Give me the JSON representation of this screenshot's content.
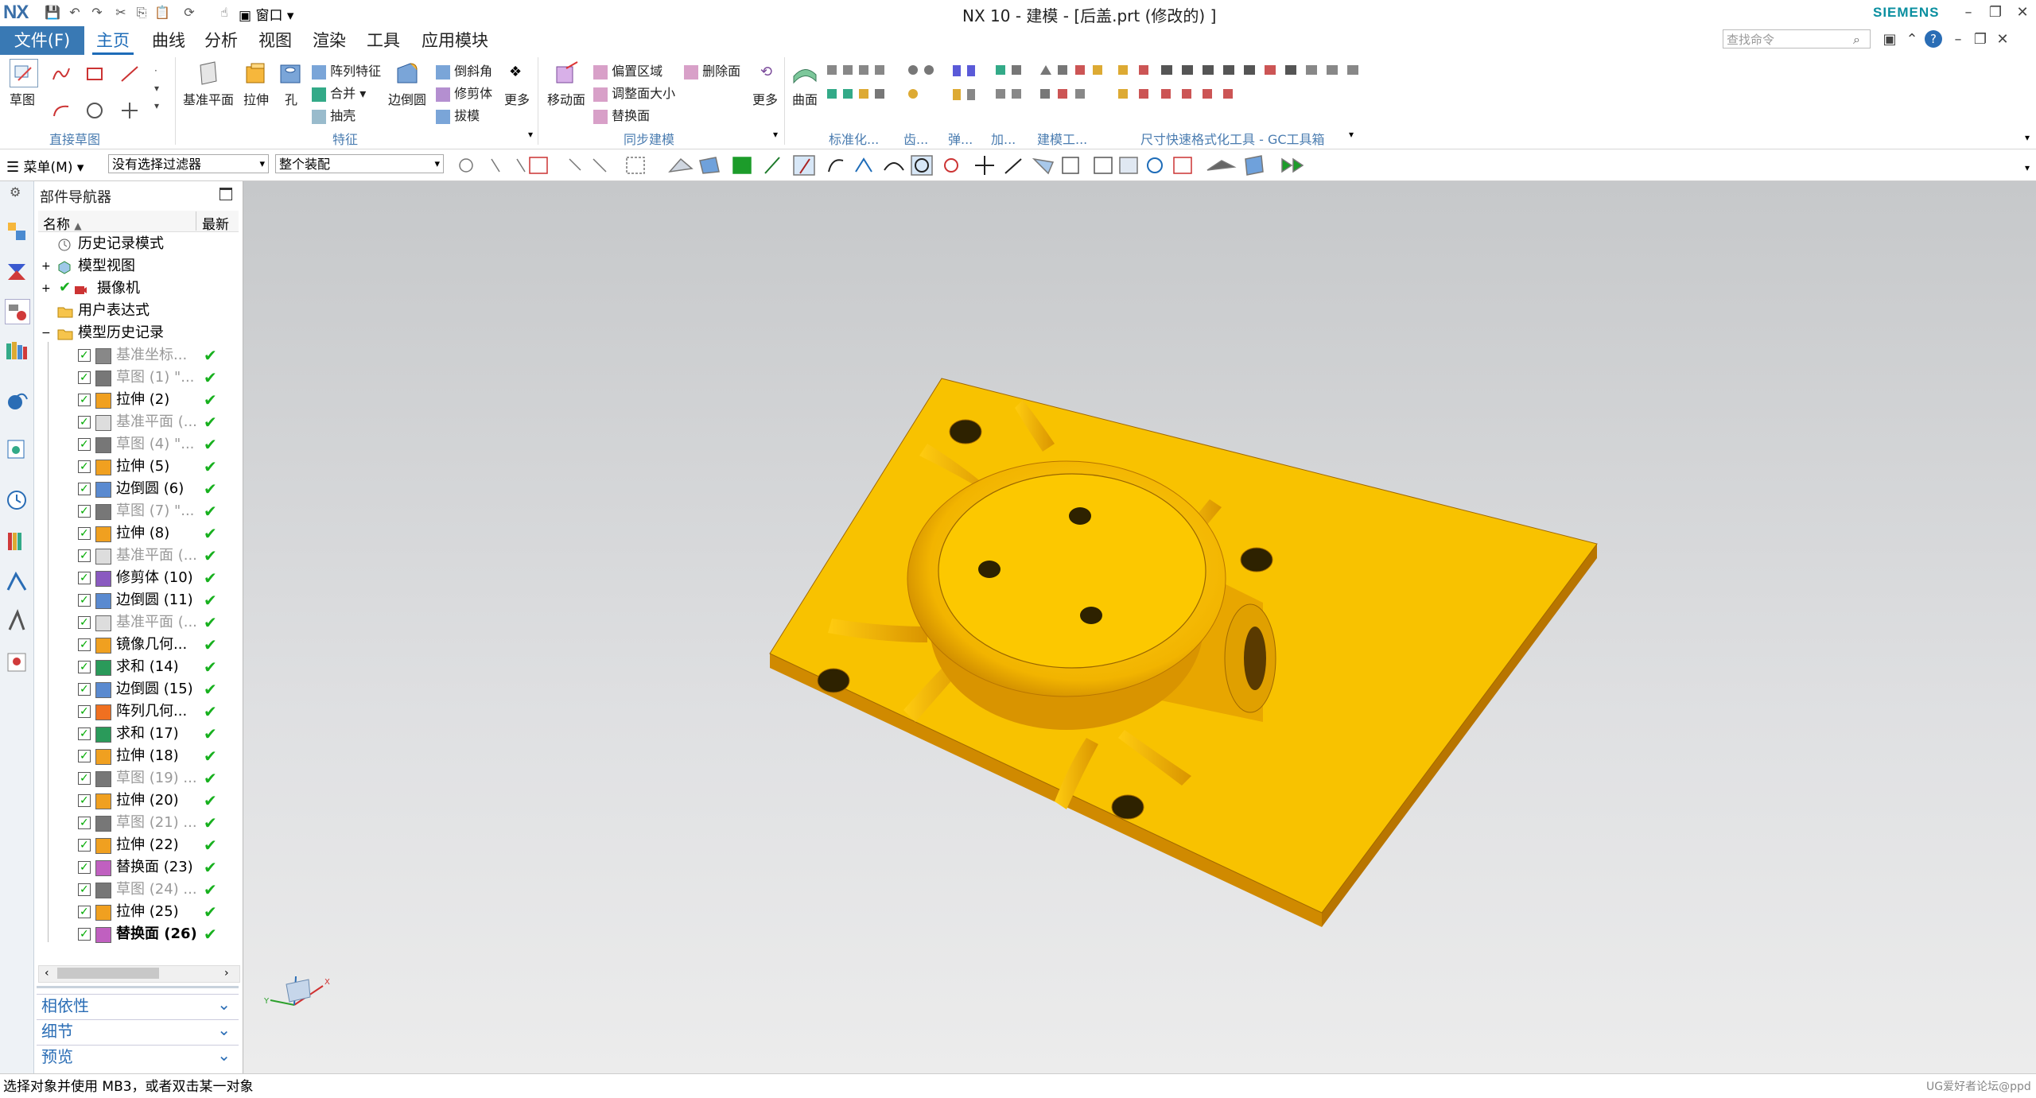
{
  "app": {
    "logo": "NX",
    "window_title": "NX 10 - 建模 - [后盖.prt  (修改的) ]",
    "brand": "SIEMENS",
    "quick_window_label": "窗口"
  },
  "menu": {
    "file": "文件(F)",
    "tabs": [
      "主页",
      "曲线",
      "分析",
      "视图",
      "渲染",
      "工具",
      "应用模块"
    ],
    "search_placeholder": "查找命令"
  },
  "ribbon": {
    "sketch": "草图",
    "datum_plane": "基准平面",
    "extrude": "拉伸",
    "hole": "孔",
    "pattern_feature": "阵列特征",
    "unite": "合并",
    "shell": "抽壳",
    "edge_blend": "边倒圆",
    "chamfer": "倒斜角",
    "trim_body": "修剪体",
    "draft": "拔模",
    "more": "更多",
    "move_face": "移动面",
    "offset_region": "偏置区域",
    "resize_face": "调整面大小",
    "replace_face": "替换面",
    "delete_face": "删除面",
    "more2": "更多",
    "surface": "曲面",
    "groups": {
      "direct_sketch": "直接草图",
      "feature": "特征",
      "sync_modeling": "同步建模",
      "standard": "标准化...",
      "gear": "齿...",
      "spring": "弹...",
      "machining": "加...",
      "build_tools": "建模工...",
      "gc_toolkit": "尺寸快速格式化工具 - GC工具箱"
    }
  },
  "toolbar2": {
    "menu_label": "菜单(M)",
    "filter": "没有选择过滤器",
    "assembly_scope": "整个装配"
  },
  "navigator": {
    "title": "部件导航器",
    "col_name": "名称",
    "col_latest": "最新",
    "top_items": [
      {
        "label": "历史记录模式"
      },
      {
        "label": "模型视图"
      },
      {
        "label": "摄像机"
      },
      {
        "label": "用户表达式"
      },
      {
        "label": "模型历史记录"
      }
    ],
    "features": [
      {
        "label": "基准坐标...",
        "grey": true,
        "icon": "datum-csys-icon"
      },
      {
        "label": "草图 (1) \"...",
        "grey": true,
        "icon": "sketch-icon"
      },
      {
        "label": "拉伸 (2)",
        "grey": false,
        "icon": "extrude-icon"
      },
      {
        "label": "基准平面 (...",
        "grey": true,
        "icon": "datum-plane-icon"
      },
      {
        "label": "草图 (4) \"...",
        "grey": true,
        "icon": "sketch-icon"
      },
      {
        "label": "拉伸 (5)",
        "grey": false,
        "icon": "extrude-icon"
      },
      {
        "label": "边倒圆 (6)",
        "grey": false,
        "icon": "edge-blend-icon"
      },
      {
        "label": "草图 (7) \"...",
        "grey": true,
        "icon": "sketch-icon"
      },
      {
        "label": "拉伸 (8)",
        "grey": false,
        "icon": "extrude-icon"
      },
      {
        "label": "基准平面 (...",
        "grey": true,
        "icon": "datum-plane-icon"
      },
      {
        "label": "修剪体 (10)",
        "grey": false,
        "icon": "trim-body-icon"
      },
      {
        "label": "边倒圆 (11)",
        "grey": false,
        "icon": "edge-blend-icon"
      },
      {
        "label": "基准平面 (...",
        "grey": true,
        "icon": "datum-plane-icon"
      },
      {
        "label": "镜像几何...",
        "grey": false,
        "icon": "mirror-icon"
      },
      {
        "label": "求和 (14)",
        "grey": false,
        "icon": "unite-icon"
      },
      {
        "label": "边倒圆 (15)",
        "grey": false,
        "icon": "edge-blend-icon"
      },
      {
        "label": "阵列几何...",
        "grey": false,
        "icon": "pattern-icon"
      },
      {
        "label": "求和 (17)",
        "grey": false,
        "icon": "unite-icon"
      },
      {
        "label": "拉伸 (18)",
        "grey": false,
        "icon": "extrude-icon"
      },
      {
        "label": "草图 (19) ...",
        "grey": true,
        "icon": "sketch-icon"
      },
      {
        "label": "拉伸 (20)",
        "grey": false,
        "icon": "extrude-icon"
      },
      {
        "label": "草图 (21) ...",
        "grey": true,
        "icon": "sketch-icon"
      },
      {
        "label": "拉伸 (22)",
        "grey": false,
        "icon": "extrude-icon"
      },
      {
        "label": "替换面 (23)",
        "grey": false,
        "icon": "replace-face-icon"
      },
      {
        "label": "草图 (24) ...",
        "grey": true,
        "icon": "sketch-icon"
      },
      {
        "label": "拉伸 (25)",
        "grey": false,
        "icon": "extrude-icon"
      },
      {
        "label": "替换面 (26)",
        "grey": false,
        "bold": true,
        "icon": "replace-face-icon"
      }
    ],
    "panels": [
      "相依性",
      "细节",
      "预览"
    ]
  },
  "status": {
    "message": "选择对象并使用 MB3，或者双击某一对象",
    "watermark": "UG爱好者论坛@ppd"
  },
  "colors": {
    "accent": "#3979b4",
    "model_yellow": "#f8c200",
    "check_green": "#17b01e"
  }
}
